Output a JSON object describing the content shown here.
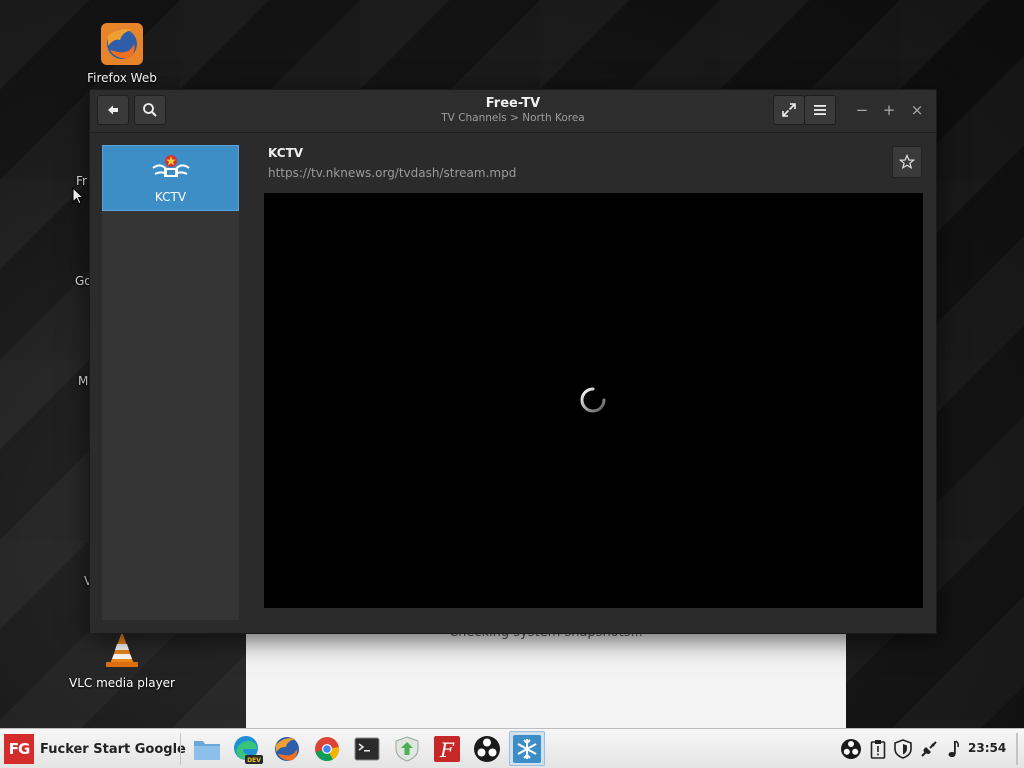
{
  "desktop": {
    "icons": [
      {
        "label": "Firefox Web"
      },
      {
        "label": "VLC media player"
      }
    ],
    "partial_labels": [
      "Fr",
      "Go",
      "M",
      "V"
    ]
  },
  "background_window": {
    "message": "Checking system snapshots..."
  },
  "app": {
    "title": "Free-TV",
    "subtitle": "TV Channels > North Korea",
    "header_buttons": {
      "back": "back-icon",
      "search": "search-icon",
      "fullscreen": "fullscreen-icon",
      "menu": "menu-icon"
    },
    "window_controls": {
      "minimize": "−",
      "maximize": "+",
      "close": "×"
    },
    "sidebar": {
      "channels": [
        {
          "label": "KCTV",
          "selected": true
        }
      ]
    },
    "channel": {
      "name": "KCTV",
      "url": "https://tv.nknews.org/tvdash/stream.mpd"
    },
    "player": {
      "state": "loading"
    }
  },
  "taskbar": {
    "start_logo": "FG",
    "start_label": "Fucker Start Google",
    "apps": [
      "file-manager-icon",
      "edge-dev-icon",
      "firefox-icon",
      "chrome-icon",
      "terminal-icon",
      "update-manager-icon",
      "font-manager-icon",
      "obs-icon",
      "freetv-icon"
    ],
    "active_app": "freetv-icon",
    "tray": [
      "obs-tray-icon",
      "clipboard-icon",
      "shield-icon",
      "network-icon",
      "volume-icon"
    ],
    "clock": "23:54"
  },
  "colors": {
    "accent": "#3d8ec7",
    "window_bg": "#2b2b2b",
    "start_red": "#d42b2b"
  }
}
